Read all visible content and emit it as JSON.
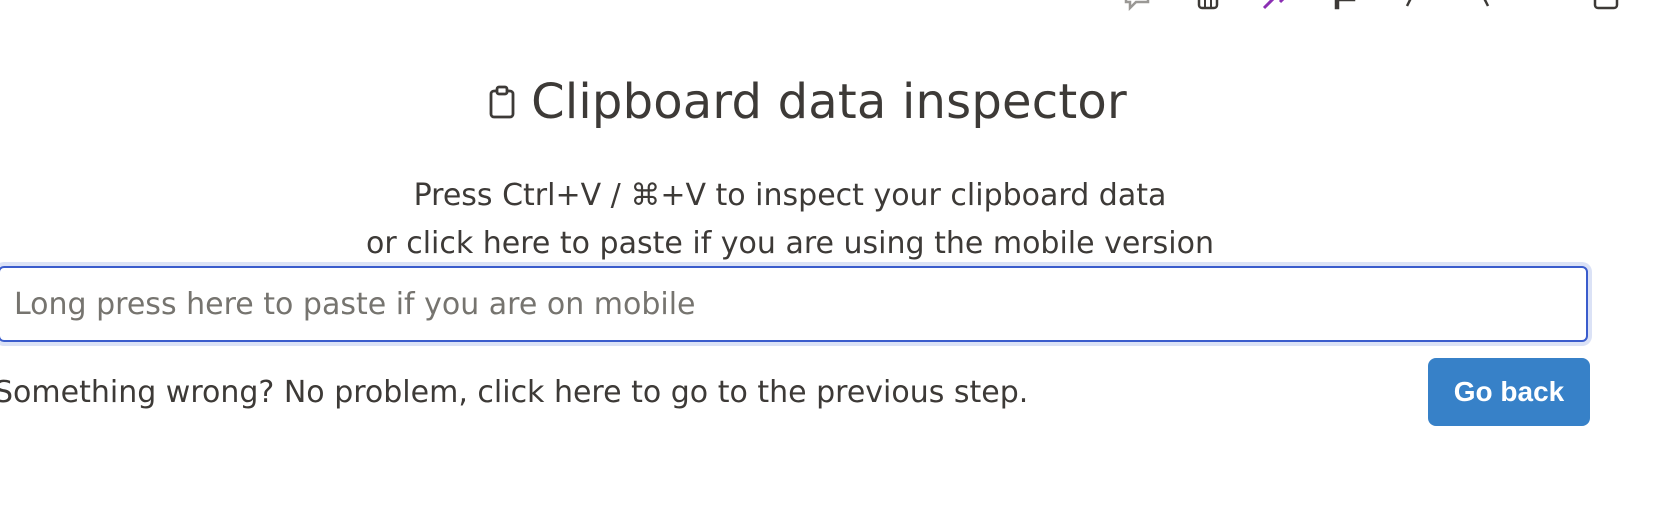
{
  "toolbar": {
    "icons": [
      "comment-icon",
      "grid-icon",
      "edit-icon",
      "puzzle-icon",
      "chevron-left-icon",
      "chevron-right-icon",
      "panel-icon"
    ]
  },
  "header": {
    "icon": "clipboard-icon",
    "title": "Clipboard data inspector"
  },
  "instructions": {
    "line1": "Press Ctrl+V / ⌘+V to inspect your clipboard data",
    "line2": "or click here to paste if you are using the mobile version"
  },
  "paste_field": {
    "value": "",
    "placeholder": "Long press here to paste if you are on mobile"
  },
  "back": {
    "text": "Something wrong? No problem, click here to go to the previous step.",
    "button_label": "Go back"
  },
  "colors": {
    "text": "#3d3a37",
    "accent": "#3781c8",
    "input_border": "#3a5ccc",
    "edit_icon": "#8b2fb3"
  }
}
